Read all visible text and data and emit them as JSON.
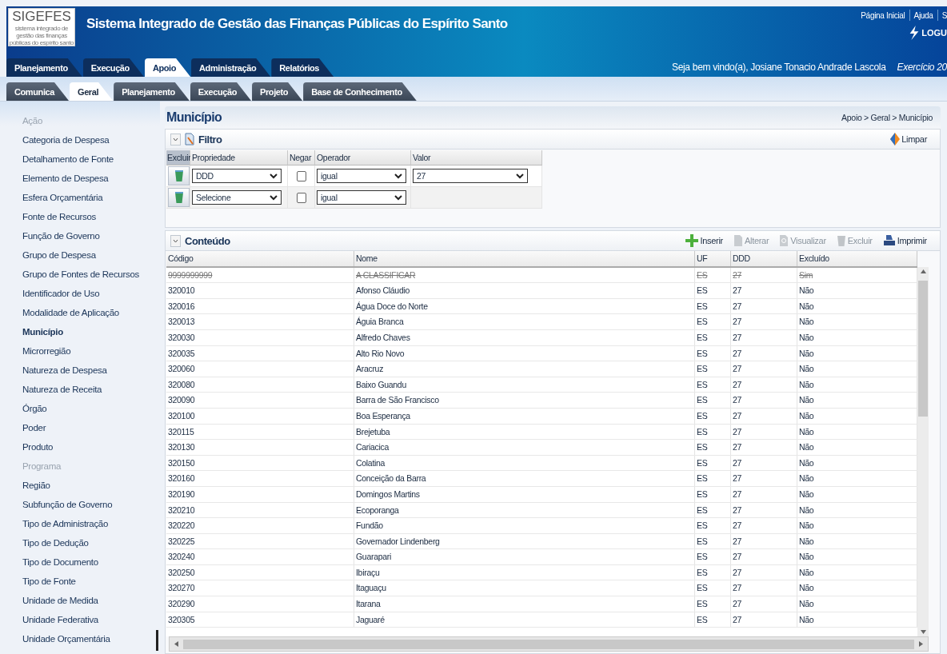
{
  "header": {
    "logo": "SIGEFES",
    "logo_subtitle": "sistema integrado de gestão das finanças públicas do espírito santo",
    "title": "Sistema Integrado de Gestão das Finanças Públicas do Espírito Santo",
    "links": [
      "Página Inicial",
      "Ajuda",
      "S"
    ],
    "brand": "LOGU",
    "welcome": "Seja bem vindo(a), Josiane Tonacio Andrade Lascola",
    "exercise": "Exercício 20"
  },
  "main_tabs": [
    {
      "label": "Planejamento",
      "selected": false
    },
    {
      "label": "Execução",
      "selected": false
    },
    {
      "label": "Apoio",
      "selected": true
    },
    {
      "label": "Administração",
      "selected": false
    },
    {
      "label": "Relatórios",
      "selected": false
    }
  ],
  "sub_tabs": [
    {
      "label": "Comunica",
      "selected": false
    },
    {
      "label": "Geral",
      "selected": true
    },
    {
      "label": "Planejamento",
      "selected": false
    },
    {
      "label": "Execução",
      "selected": false
    },
    {
      "label": "Projeto",
      "selected": false
    },
    {
      "label": "Base de Conhecimento",
      "selected": false
    }
  ],
  "sidebar": {
    "items": [
      {
        "label": "Ação",
        "disabled": true,
        "selected": false
      },
      {
        "label": "Categoria de Despesa",
        "disabled": false,
        "selected": false
      },
      {
        "label": "Detalhamento de Fonte",
        "disabled": false,
        "selected": false
      },
      {
        "label": "Elemento de Despesa",
        "disabled": false,
        "selected": false
      },
      {
        "label": "Esfera Orçamentária",
        "disabled": false,
        "selected": false
      },
      {
        "label": "Fonte de Recursos",
        "disabled": false,
        "selected": false
      },
      {
        "label": "Função de Governo",
        "disabled": false,
        "selected": false
      },
      {
        "label": "Grupo de Despesa",
        "disabled": false,
        "selected": false
      },
      {
        "label": "Grupo de Fontes de Recursos",
        "disabled": false,
        "selected": false
      },
      {
        "label": "Identificador de Uso",
        "disabled": false,
        "selected": false
      },
      {
        "label": "Modalidade de Aplicação",
        "disabled": false,
        "selected": false
      },
      {
        "label": "Município",
        "disabled": false,
        "selected": true
      },
      {
        "label": "Microrregião",
        "disabled": false,
        "selected": false
      },
      {
        "label": "Natureza de Despesa",
        "disabled": false,
        "selected": false
      },
      {
        "label": "Natureza de Receita",
        "disabled": false,
        "selected": false
      },
      {
        "label": "Órgão",
        "disabled": false,
        "selected": false
      },
      {
        "label": "Poder",
        "disabled": false,
        "selected": false
      },
      {
        "label": "Produto",
        "disabled": false,
        "selected": false
      },
      {
        "label": "Programa",
        "disabled": true,
        "selected": false
      },
      {
        "label": "Região",
        "disabled": false,
        "selected": false
      },
      {
        "label": "Subfunção de Governo",
        "disabled": false,
        "selected": false
      },
      {
        "label": "Tipo de Administração",
        "disabled": false,
        "selected": false
      },
      {
        "label": "Tipo de Dedução",
        "disabled": false,
        "selected": false
      },
      {
        "label": "Tipo de Documento",
        "disabled": false,
        "selected": false
      },
      {
        "label": "Tipo de Fonte",
        "disabled": false,
        "selected": false
      },
      {
        "label": "Unidade de Medida",
        "disabled": false,
        "selected": false
      },
      {
        "label": "Unidade Federativa",
        "disabled": false,
        "selected": false
      },
      {
        "label": "Unidade Orçamentária",
        "disabled": false,
        "selected": false
      }
    ]
  },
  "page": {
    "title": "Município",
    "breadcrumb": "Apoio > Geral > Município"
  },
  "filter": {
    "title": "Filtro",
    "clear": "Limpar",
    "columns": [
      "Excluir",
      "Propriedade",
      "Negar",
      "Operador",
      "Valor"
    ],
    "rows": [
      {
        "property": "DDD",
        "negate": false,
        "operator": "igual",
        "value": "27"
      },
      {
        "property": "Selecione",
        "negate": false,
        "operator": "igual"
      }
    ]
  },
  "content": {
    "title": "Conteúdo",
    "actions": [
      {
        "label": "Inserir",
        "kind": "insert",
        "disabled": false
      },
      {
        "label": "Alterar",
        "kind": "edit",
        "disabled": true
      },
      {
        "label": "Visualizar",
        "kind": "view",
        "disabled": true
      },
      {
        "label": "Excluir",
        "kind": "delete",
        "disabled": true
      },
      {
        "label": "Imprimir",
        "kind": "print",
        "disabled": false
      }
    ],
    "table": {
      "columns": [
        "Código",
        "Nome",
        "UF",
        "DDD",
        "Excluído"
      ],
      "rows": [
        {
          "cells": [
            "9999999999",
            "A CLASSIFICAR",
            "ES",
            "27",
            "Sim"
          ],
          "deleted": true
        },
        {
          "cells": [
            "320010",
            "Afonso Cláudio",
            "ES",
            "27",
            "Não"
          ],
          "deleted": false
        },
        {
          "cells": [
            "320016",
            "Água Doce do Norte",
            "ES",
            "27",
            "Não"
          ],
          "deleted": false
        },
        {
          "cells": [
            "320013",
            "Águia Branca",
            "ES",
            "27",
            "Não"
          ],
          "deleted": false
        },
        {
          "cells": [
            "320030",
            "Alfredo Chaves",
            "ES",
            "27",
            "Não"
          ],
          "deleted": false
        },
        {
          "cells": [
            "320035",
            "Alto Rio Novo",
            "ES",
            "27",
            "Não"
          ],
          "deleted": false
        },
        {
          "cells": [
            "320060",
            "Aracruz",
            "ES",
            "27",
            "Não"
          ],
          "deleted": false
        },
        {
          "cells": [
            "320080",
            "Baixo Guandu",
            "ES",
            "27",
            "Não"
          ],
          "deleted": false
        },
        {
          "cells": [
            "320090",
            "Barra de São Francisco",
            "ES",
            "27",
            "Não"
          ],
          "deleted": false
        },
        {
          "cells": [
            "320100",
            "Boa Esperança",
            "ES",
            "27",
            "Não"
          ],
          "deleted": false
        },
        {
          "cells": [
            "320115",
            "Brejetuba",
            "ES",
            "27",
            "Não"
          ],
          "deleted": false
        },
        {
          "cells": [
            "320130",
            "Cariacica",
            "ES",
            "27",
            "Não"
          ],
          "deleted": false
        },
        {
          "cells": [
            "320150",
            "Colatina",
            "ES",
            "27",
            "Não"
          ],
          "deleted": false
        },
        {
          "cells": [
            "320160",
            "Conceição da Barra",
            "ES",
            "27",
            "Não"
          ],
          "deleted": false
        },
        {
          "cells": [
            "320190",
            "Domingos Martins",
            "ES",
            "27",
            "Não"
          ],
          "deleted": false
        },
        {
          "cells": [
            "320210",
            "Ecoporanga",
            "ES",
            "27",
            "Não"
          ],
          "deleted": false
        },
        {
          "cells": [
            "320220",
            "Fundão",
            "ES",
            "27",
            "Não"
          ],
          "deleted": false
        },
        {
          "cells": [
            "320225",
            "Governador Lindenberg",
            "ES",
            "27",
            "Não"
          ],
          "deleted": false
        },
        {
          "cells": [
            "320240",
            "Guarapari",
            "ES",
            "27",
            "Não"
          ],
          "deleted": false
        },
        {
          "cells": [
            "320250",
            "Ibiraçu",
            "ES",
            "27",
            "Não"
          ],
          "deleted": false
        },
        {
          "cells": [
            "320270",
            "Itaguaçu",
            "ES",
            "27",
            "Não"
          ],
          "deleted": false
        },
        {
          "cells": [
            "320290",
            "Itarana",
            "ES",
            "27",
            "Não"
          ],
          "deleted": false
        },
        {
          "cells": [
            "320305",
            "Jaguaré",
            "ES",
            "27",
            "Não"
          ],
          "deleted": false
        }
      ]
    }
  }
}
